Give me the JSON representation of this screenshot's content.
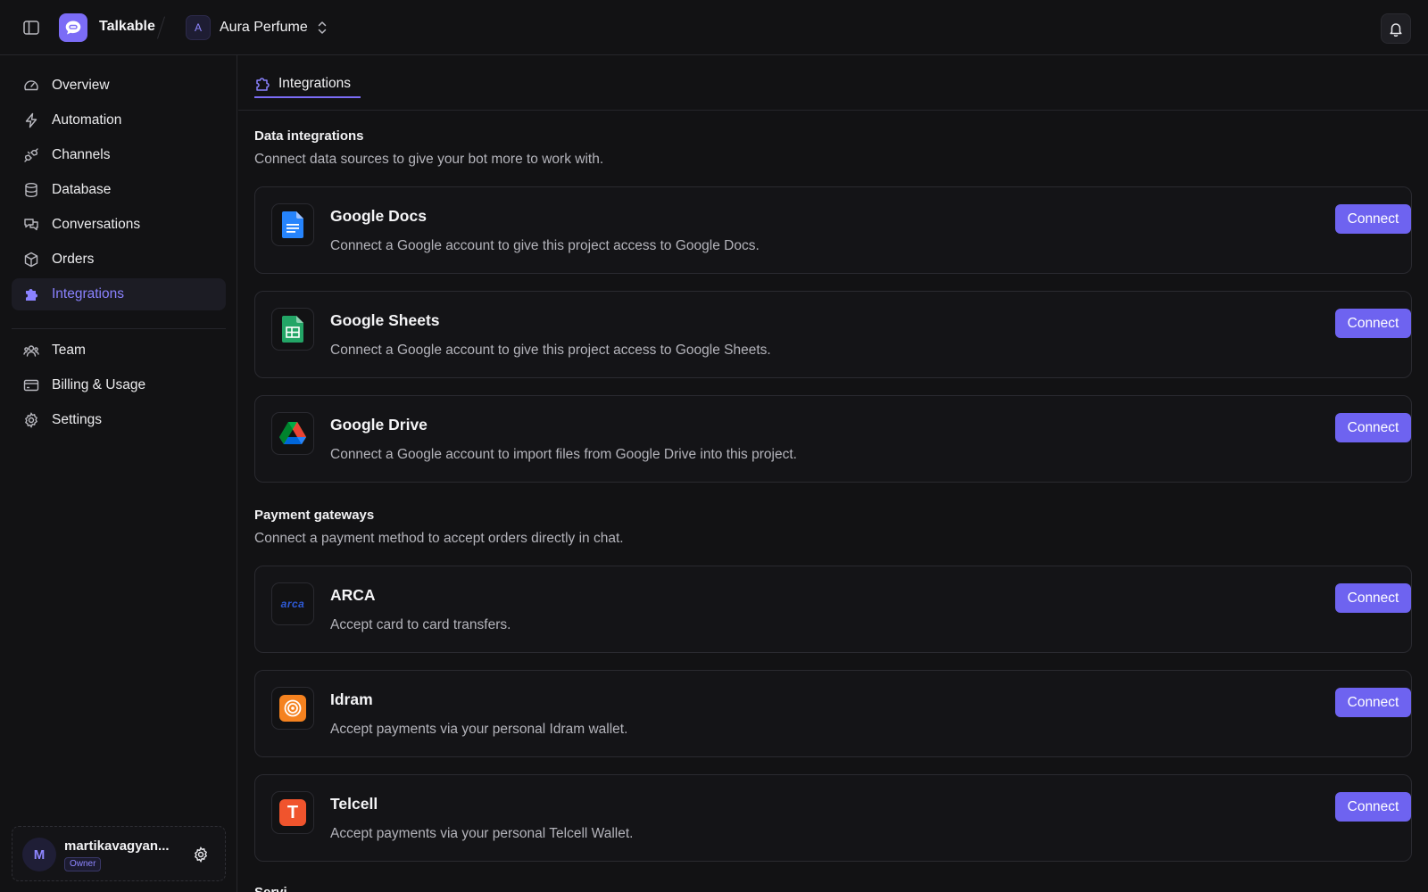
{
  "header": {
    "app_name": "Talkable",
    "project_initial": "A",
    "project_name": "Aura Perfume"
  },
  "sidebar": {
    "items": [
      {
        "label": "Overview",
        "icon": "gauge-icon"
      },
      {
        "label": "Automation",
        "icon": "bolt-icon"
      },
      {
        "label": "Channels",
        "icon": "plug-icon"
      },
      {
        "label": "Database",
        "icon": "database-icon"
      },
      {
        "label": "Conversations",
        "icon": "chat-bubbles-icon"
      },
      {
        "label": "Orders",
        "icon": "box-icon"
      },
      {
        "label": "Integrations",
        "icon": "puzzle-icon",
        "active": true
      }
    ],
    "secondary_items": [
      {
        "label": "Team",
        "icon": "users-icon"
      },
      {
        "label": "Billing & Usage",
        "icon": "credit-card-icon"
      },
      {
        "label": "Settings",
        "icon": "gear-icon"
      }
    ],
    "user": {
      "initial": "M",
      "name": "martikavagyan...",
      "role": "Owner"
    }
  },
  "main": {
    "tab_label": "Integrations",
    "data_section": {
      "title": "Data integrations",
      "description": "Connect data sources to give your bot more to work with.",
      "items": [
        {
          "name": "Google Docs",
          "description": "Connect a Google account to give this project access to Google Docs.",
          "button": "Connect",
          "icon": "google-docs-icon"
        },
        {
          "name": "Google Sheets",
          "description": "Connect a Google account to give this project access to Google Sheets.",
          "button": "Connect",
          "icon": "google-sheets-icon"
        },
        {
          "name": "Google Drive",
          "description": "Connect a Google account to import files from Google Drive into this project.",
          "button": "Connect",
          "icon": "google-drive-icon"
        }
      ]
    },
    "payment_section": {
      "title": "Payment gateways",
      "description": "Connect a payment method to accept orders directly in chat.",
      "items": [
        {
          "name": "ARCA",
          "description": "Accept card to card transfers.",
          "button": "Connect",
          "icon": "arca-logo-icon",
          "logo_text": "arca"
        },
        {
          "name": "Idram",
          "description": "Accept payments via your personal Idram wallet.",
          "button": "Connect",
          "icon": "idram-logo-icon"
        },
        {
          "name": "Telcell",
          "description": "Accept payments via your personal Telcell Wallet.",
          "button": "Connect",
          "icon": "telcell-logo-icon",
          "logo_text": "T"
        }
      ]
    },
    "next_section_partial": "Servi"
  },
  "colors": {
    "background": "#121214",
    "accent": "#6e63f0",
    "active_text": "#8a82ff",
    "border": "#2a2a30"
  }
}
